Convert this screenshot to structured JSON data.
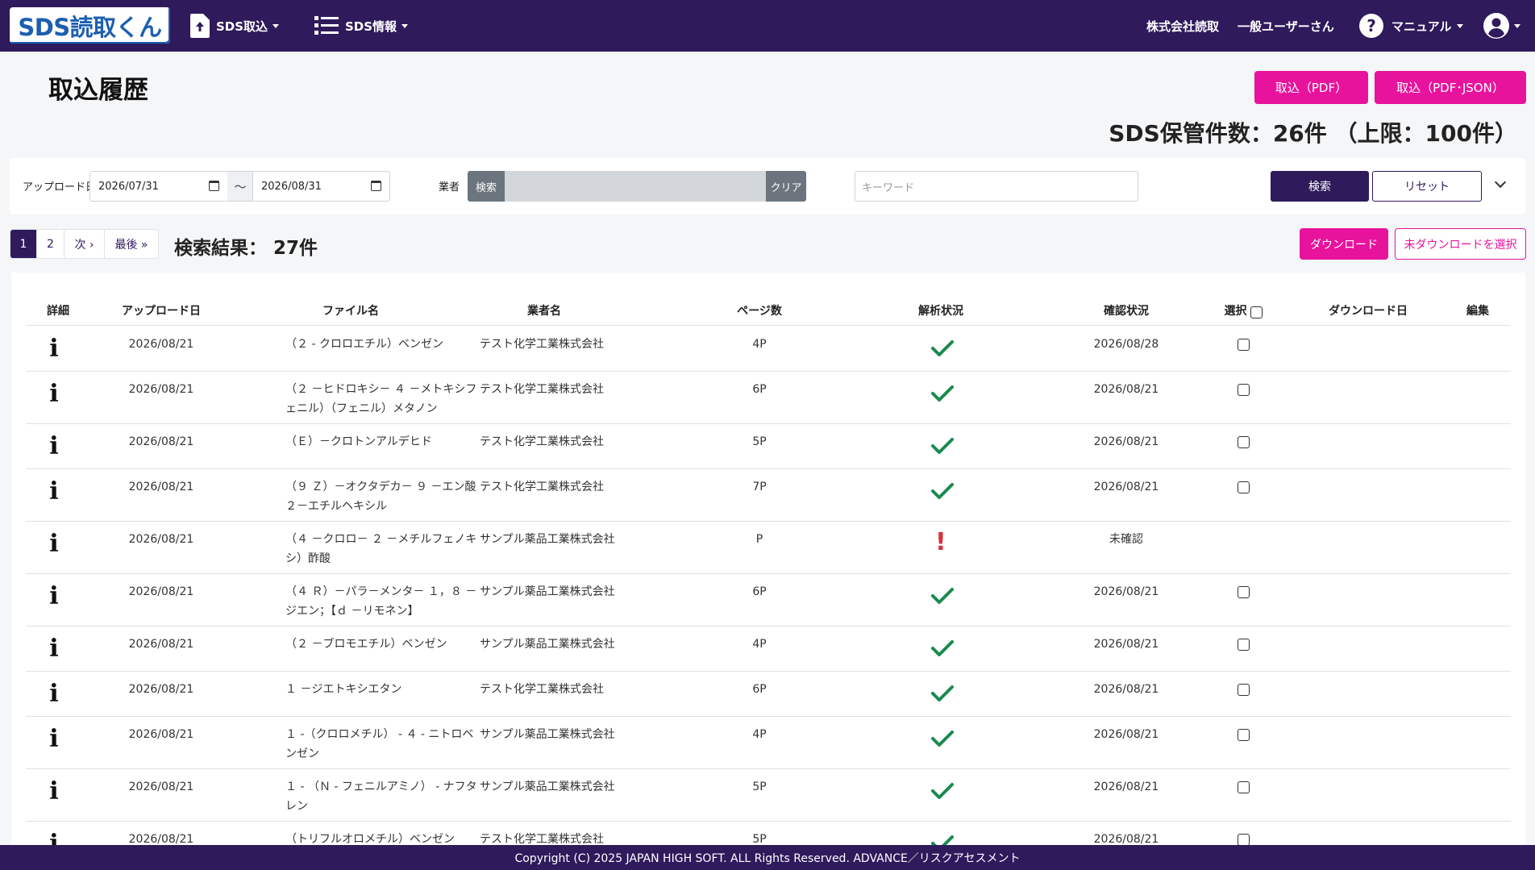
{
  "nav": {
    "logo": "SDS読取くん",
    "sds_import": "SDS取込",
    "sds_info": "SDS情報",
    "company": "株式会社読取",
    "user": "一般ユーザーさん",
    "manual": "マニュアル"
  },
  "page": {
    "title": "取込履歴",
    "import_pdf": "取込（PDF）",
    "import_pdf_json": "取込（PDF･JSON）",
    "storage_count": "SDS保管件数：26件 （上限：100件）"
  },
  "filter": {
    "upload_date_label": "アップロード日",
    "date_from": "2026/07/31",
    "tilde": "～",
    "date_to": "2026/08/31",
    "vendor_label": "業者",
    "vendor_search": "検索",
    "vendor_clear": "クリア",
    "keyword_placeholder": "キーワード",
    "search": "検索",
    "reset": "リセット"
  },
  "pagination": {
    "pages": [
      "1",
      "2"
    ],
    "next": "次 ›",
    "last": "最後 »"
  },
  "results": {
    "label": "検索結果： 27件",
    "download": "ダウンロード",
    "select_undownloaded": "未ダウンロードを選択"
  },
  "table": {
    "headers": {
      "detail": "詳細",
      "upload_date": "アップロード日",
      "file_name": "ファイル名",
      "vendor": "業者名",
      "pages": "ページ数",
      "analysis": "解析状況",
      "confirm": "確認状況",
      "select": "選択",
      "download_date": "ダウンロード日",
      "edit": "編集"
    },
    "info_icon": "i",
    "error_icon": "!",
    "rows": [
      {
        "date": "2026/08/21",
        "file": "（２ - クロロエチル）ベンゼン",
        "vendor": "テスト化学工業株式会社",
        "pages": "4P",
        "status": "ok",
        "confirm": "2026/08/28",
        "checkbox": true
      },
      {
        "date": "2026/08/21",
        "file": "（２ －ヒドロキシ－ ４ －メトキシフェニル）（フェニル）メタノン",
        "vendor": "テスト化学工業株式会社",
        "pages": "6P",
        "status": "ok",
        "confirm": "2026/08/21",
        "checkbox": true
      },
      {
        "date": "2026/08/21",
        "file": "（Ｅ）－クロトンアルデヒド",
        "vendor": "テスト化学工業株式会社",
        "pages": "5P",
        "status": "ok",
        "confirm": "2026/08/21",
        "checkbox": true
      },
      {
        "date": "2026/08/21",
        "file": "（９ Ｚ）－オクタデカ－ ９ －エン酸２－エチルヘキシル",
        "vendor": "テスト化学工業株式会社",
        "pages": "7P",
        "status": "ok",
        "confirm": "2026/08/21",
        "checkbox": true
      },
      {
        "date": "2026/08/21",
        "file": "（４ －クロロ－ ２ －メチルフェノキシ）酢酸",
        "vendor": "サンプル薬品工業株式会社",
        "pages": "P",
        "status": "error",
        "confirm": "未確認",
        "checkbox": false
      },
      {
        "date": "2026/08/21",
        "file": "（４ Ｒ）－パラ－メンタ－ １，８ －ジエン；【ｄ －リモネン】",
        "vendor": "サンプル薬品工業株式会社",
        "pages": "6P",
        "status": "ok",
        "confirm": "2026/08/21",
        "checkbox": true
      },
      {
        "date": "2026/08/21",
        "file": "（２ －ブロモエチル）ベンゼン",
        "vendor": "サンプル薬品工業株式会社",
        "pages": "4P",
        "status": "ok",
        "confirm": "2026/08/21",
        "checkbox": true
      },
      {
        "date": "2026/08/21",
        "file": "１ －ジエトキシエタン",
        "vendor": "テスト化学工業株式会社",
        "pages": "6P",
        "status": "ok",
        "confirm": "2026/08/21",
        "checkbox": true
      },
      {
        "date": "2026/08/21",
        "file": "１ -（クロロメチル） - ４ - ニトロベンゼン",
        "vendor": "サンプル薬品工業株式会社",
        "pages": "4P",
        "status": "ok",
        "confirm": "2026/08/21",
        "checkbox": true
      },
      {
        "date": "2026/08/21",
        "file": "１ - （Ｎ - フェニルアミノ） - ナフタレン",
        "vendor": "サンプル薬品工業株式会社",
        "pages": "5P",
        "status": "ok",
        "confirm": "2026/08/21",
        "checkbox": true
      },
      {
        "date": "2026/08/21",
        "file": "（トリフルオロメチル）ベンゼン",
        "vendor": "テスト化学工業株式会社",
        "pages": "5P",
        "status": "ok",
        "confirm": "2026/08/21",
        "checkbox": true
      }
    ]
  },
  "footer": "Copyright (C) 2025 JAPAN HIGH SOFT. ALL Rights Reserved. ADVANCE／リスクアセスメント",
  "colors": {
    "primary": "#2f1a5c",
    "accent": "#e8139c",
    "ok": "#1a8a4e",
    "error": "#dc2e3c"
  }
}
